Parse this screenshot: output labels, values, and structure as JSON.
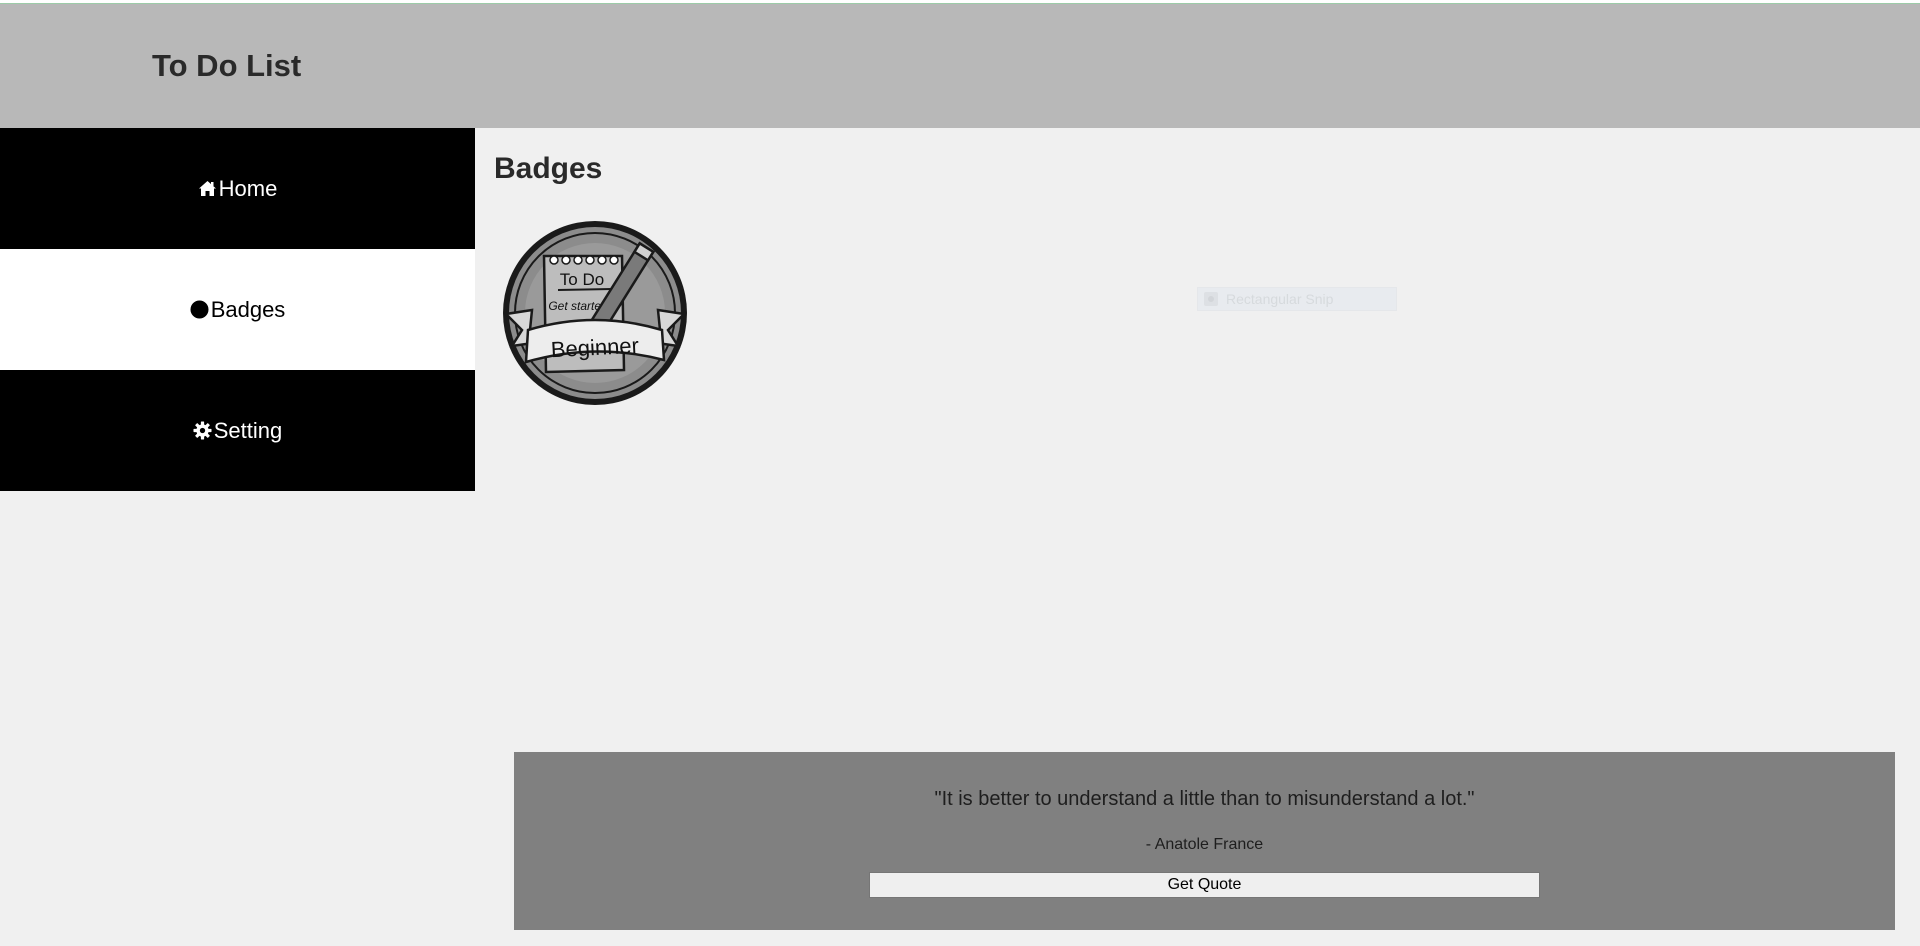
{
  "header": {
    "title": "To Do List"
  },
  "sidebar": {
    "items": [
      {
        "label": "Home",
        "icon": "home-icon",
        "active": false
      },
      {
        "label": "Badges",
        "icon": "circle-icon",
        "active": true
      },
      {
        "label": "Setting",
        "icon": "gear-icon",
        "active": false
      }
    ]
  },
  "main": {
    "title": "Badges",
    "badges": [
      {
        "line1": "To Do",
        "line2": "Get started",
        "ribbon": "Beginner"
      }
    ],
    "snip_overlay": {
      "label": "Rectangular Snip"
    }
  },
  "quote": {
    "text": "\"It is better to understand a little than to misunderstand a lot.\"",
    "author": "- Anatole France",
    "button_label": "Get Quote"
  },
  "colors": {
    "header_bg": "#b8b8b8",
    "nav_dark": "#000000",
    "nav_active": "#ffffff",
    "content_bg": "#f0f0f0",
    "quote_bg": "#808080"
  }
}
